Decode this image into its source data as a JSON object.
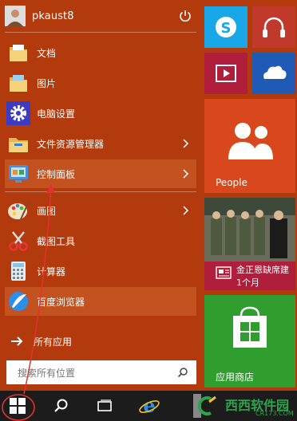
{
  "user": {
    "name": "pkaust8"
  },
  "menu": {
    "items": [
      {
        "label": "文档",
        "icon": "folder-documents-icon",
        "has_submenu": false
      },
      {
        "label": "图片",
        "icon": "folder-pictures-icon",
        "has_submenu": false
      },
      {
        "label": "电脑设置",
        "icon": "settings-gear-icon",
        "has_submenu": false
      },
      {
        "label": "文件资源管理器",
        "icon": "file-explorer-icon",
        "has_submenu": true
      },
      {
        "label": "控制面板",
        "icon": "control-panel-icon",
        "has_submenu": true
      },
      {
        "label": "画图",
        "icon": "paint-icon",
        "has_submenu": true
      },
      {
        "label": "截图工具",
        "icon": "snipping-tool-icon",
        "has_submenu": false
      },
      {
        "label": "计算器",
        "icon": "calculator-icon",
        "has_submenu": false
      },
      {
        "label": "百度浏览器",
        "icon": "baidu-browser-icon",
        "has_submenu": false
      }
    ],
    "all_apps_label": "所有应用"
  },
  "search": {
    "placeholder": "搜索所有位置"
  },
  "tiles": {
    "people_label": "People",
    "news_title": "金正恩缺席建",
    "news_sub": "1个月",
    "store_label": "应用商店"
  },
  "watermark": {
    "text": "西西软件园",
    "sub": "CR173.COM"
  },
  "colors": {
    "start_bg": "#b23a0c",
    "highlight": "#c35220",
    "taskbar": "#1c1c1c",
    "skype_tile": "#1aa7e8",
    "music_tile": "#c0392b",
    "video_tile": "#b01e3c",
    "onedrive_tile": "#1f5ab5",
    "people_tile": "#d9481c",
    "news_tile": "#b01e3c",
    "store_tile": "#2f9e2f",
    "annotation": "#e23232"
  }
}
